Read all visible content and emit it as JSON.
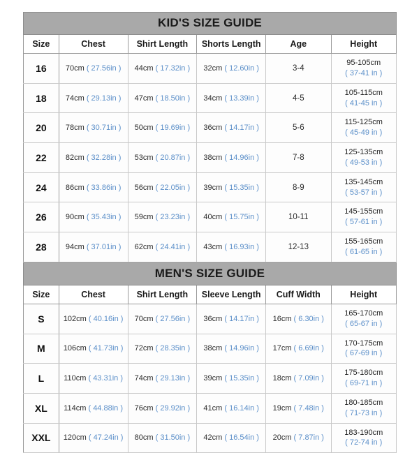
{
  "kids": {
    "title": "KID'S SIZE GUIDE",
    "columns": [
      "Size",
      "Chest",
      "Shirt Length",
      "Shorts Length",
      "Age",
      "Height"
    ],
    "rows": [
      {
        "size": "16",
        "chest_cm": "70cm",
        "chest_in": "( 27.56in )",
        "shirt_cm": "44cm",
        "shirt_in": "( 17.32in )",
        "shorts_cm": "32cm",
        "shorts_in": "( 12.60in )",
        "age": "3-4",
        "height_cm": "95-105cm",
        "height_in": "( 37-41 in )"
      },
      {
        "size": "18",
        "chest_cm": "74cm",
        "chest_in": "( 29.13in )",
        "shirt_cm": "47cm",
        "shirt_in": "( 18.50in )",
        "shorts_cm": "34cm",
        "shorts_in": "( 13.39in )",
        "age": "4-5",
        "height_cm": "105-115cm",
        "height_in": "( 41-45 in )"
      },
      {
        "size": "20",
        "chest_cm": "78cm",
        "chest_in": "( 30.71in )",
        "shirt_cm": "50cm",
        "shirt_in": "( 19.69in )",
        "shorts_cm": "36cm",
        "shorts_in": "( 14.17in )",
        "age": "5-6",
        "height_cm": "115-125cm",
        "height_in": "( 45-49 in )"
      },
      {
        "size": "22",
        "chest_cm": "82cm",
        "chest_in": "( 32.28in )",
        "shirt_cm": "53cm",
        "shirt_in": "( 20.87in )",
        "shorts_cm": "38cm",
        "shorts_in": "( 14.96in )",
        "age": "7-8",
        "height_cm": "125-135cm",
        "height_in": "( 49-53 in )"
      },
      {
        "size": "24",
        "chest_cm": "86cm",
        "chest_in": "( 33.86in )",
        "shirt_cm": "56cm",
        "shirt_in": "( 22.05in )",
        "shorts_cm": "39cm",
        "shorts_in": "( 15.35in )",
        "age": "8-9",
        "height_cm": "135-145cm",
        "height_in": "( 53-57 in )"
      },
      {
        "size": "26",
        "chest_cm": "90cm",
        "chest_in": "( 35.43in )",
        "shirt_cm": "59cm",
        "shirt_in": "( 23.23in )",
        "shorts_cm": "40cm",
        "shorts_in": "( 15.75in )",
        "age": "10-11",
        "height_cm": "145-155cm",
        "height_in": "( 57-61 in )"
      },
      {
        "size": "28",
        "chest_cm": "94cm",
        "chest_in": "( 37.01in )",
        "shirt_cm": "62cm",
        "shirt_in": "( 24.41in )",
        "shorts_cm": "43cm",
        "shorts_in": "( 16.93in )",
        "age": "12-13",
        "height_cm": "155-165cm",
        "height_in": "( 61-65 in )"
      }
    ]
  },
  "mens": {
    "title": "MEN'S SIZE GUIDE",
    "columns": [
      "Size",
      "Chest",
      "Shirt Length",
      "Sleeve Length",
      "Cuff Width",
      "Height"
    ],
    "rows": [
      {
        "size": "S",
        "chest_cm": "102cm",
        "chest_in": "( 40.16in )",
        "shirt_cm": "70cm",
        "shirt_in": "( 27.56in )",
        "sleeve_cm": "36cm",
        "sleeve_in": "( 14.17in )",
        "cuff_cm": "16cm",
        "cuff_in": "( 6.30in )",
        "height_cm": "165-170cm",
        "height_in": "( 65-67 in )"
      },
      {
        "size": "M",
        "chest_cm": "106cm",
        "chest_in": "( 41.73in )",
        "shirt_cm": "72cm",
        "shirt_in": "( 28.35in )",
        "sleeve_cm": "38cm",
        "sleeve_in": "( 14.96in )",
        "cuff_cm": "17cm",
        "cuff_in": "( 6.69in )",
        "height_cm": "170-175cm",
        "height_in": "( 67-69 in )"
      },
      {
        "size": "L",
        "chest_cm": "110cm",
        "chest_in": "( 43.31in )",
        "shirt_cm": "74cm",
        "shirt_in": "( 29.13in )",
        "sleeve_cm": "39cm",
        "sleeve_in": "( 15.35in )",
        "cuff_cm": "18cm",
        "cuff_in": "( 7.09in )",
        "height_cm": "175-180cm",
        "height_in": "( 69-71 in )"
      },
      {
        "size": "XL",
        "chest_cm": "114cm",
        "chest_in": "( 44.88in )",
        "shirt_cm": "76cm",
        "shirt_in": "( 29.92in )",
        "sleeve_cm": "41cm",
        "sleeve_in": "( 16.14in )",
        "cuff_cm": "19cm",
        "cuff_in": "( 7.48in )",
        "height_cm": "180-185cm",
        "height_in": "( 71-73 in )"
      },
      {
        "size": "XXL",
        "chest_cm": "120cm",
        "chest_in": "( 47.24in )",
        "shirt_cm": "80cm",
        "shirt_in": "( 31.50in )",
        "sleeve_cm": "42cm",
        "sleeve_in": "( 16.54in )",
        "cuff_cm": "20cm",
        "cuff_in": "( 7.87in )",
        "height_cm": "183-190cm",
        "height_in": "( 72-74 in )"
      }
    ]
  },
  "colors": {
    "title_band": "#a9a9a9",
    "inch_text": "#5b8fc9",
    "cm_text": "#2b2b2b",
    "border": "#9a9a9a"
  }
}
